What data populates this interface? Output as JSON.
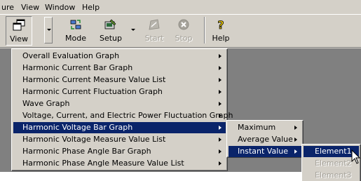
{
  "menubar": {
    "items": [
      "ure",
      "View",
      "Window",
      "Help"
    ]
  },
  "toolbar": {
    "buttons": [
      {
        "label": "View",
        "icon": "view-window-icon",
        "state": "pressed"
      },
      {
        "label": "Mode",
        "icon": "mode-icon",
        "state": "normal"
      },
      {
        "label": "Setup",
        "icon": "setup-icon",
        "state": "normal"
      },
      {
        "label": "Start",
        "icon": "start-icon",
        "state": "disabled"
      },
      {
        "label": "Stop",
        "icon": "stop-icon",
        "state": "disabled"
      },
      {
        "label": "Help",
        "icon": "help-icon",
        "state": "normal"
      }
    ]
  },
  "view_menu": {
    "items": [
      "Overall Evaluation Graph",
      "Harmonic Current Bar Graph",
      "Harmonic Current Measure Value List",
      "Harmonic Current Fluctuation Graph",
      "Wave Graph",
      "Voltage, Current, and Electric Power Fluctuation Graph",
      "Harmonic Voltage Bar Graph",
      "Harmonic Voltage Measure Value List",
      "Harmonic Phase Angle Bar Graph",
      "Harmonic Phase Angle Measure Value List"
    ],
    "highlighted": "Harmonic Voltage Bar Graph"
  },
  "value_submenu": {
    "items": [
      "Maximum",
      "Average Value",
      "Instant Value"
    ],
    "highlighted": "Instant Value"
  },
  "element_submenu": {
    "items": [
      "Element1",
      "Element2",
      "Element3"
    ],
    "highlighted": "Element1",
    "disabled": [
      "Element2",
      "Element3"
    ]
  },
  "colors": {
    "face": "#d4d0c8",
    "highlight": "#0a246a",
    "highlight_text": "#ffffff",
    "disabled_text": "#a6a39b",
    "client_area": "#808080"
  }
}
